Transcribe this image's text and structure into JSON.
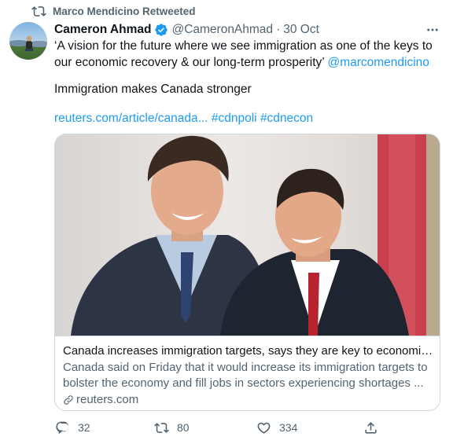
{
  "retweet": {
    "icon": "retweet-icon",
    "label": "Marco Mendicino Retweeted"
  },
  "author": {
    "display_name": "Cameron Ahmad",
    "verified": true,
    "handle": "@CameronAhmad",
    "separator": "·",
    "date": "30 Oct"
  },
  "tweet": {
    "quote": "‘A vision for the future where we see immigration as one of the keys to our economic recovery & our long-term prosperity’ ",
    "mention": "@marcomendicino",
    "statement": "Immigration makes Canada stronger",
    "link": "reuters.com/article/canada...",
    "hashtags": [
      "#cdnpoli",
      "#cdnecon"
    ]
  },
  "card": {
    "title": "Canada increases immigration targets, says they are key to economic...",
    "description": "Canada said on Friday that it would increase its immigration targets to bolster the economy and fill jobs in sectors experiencing shortages ...",
    "domain": "reuters.com"
  },
  "actions": {
    "replies": "32",
    "retweets": "80",
    "likes": "334"
  },
  "colors": {
    "accent": "#1d9bf0",
    "muted": "#536471",
    "text": "#0f1419",
    "border": "#cfd9de"
  }
}
